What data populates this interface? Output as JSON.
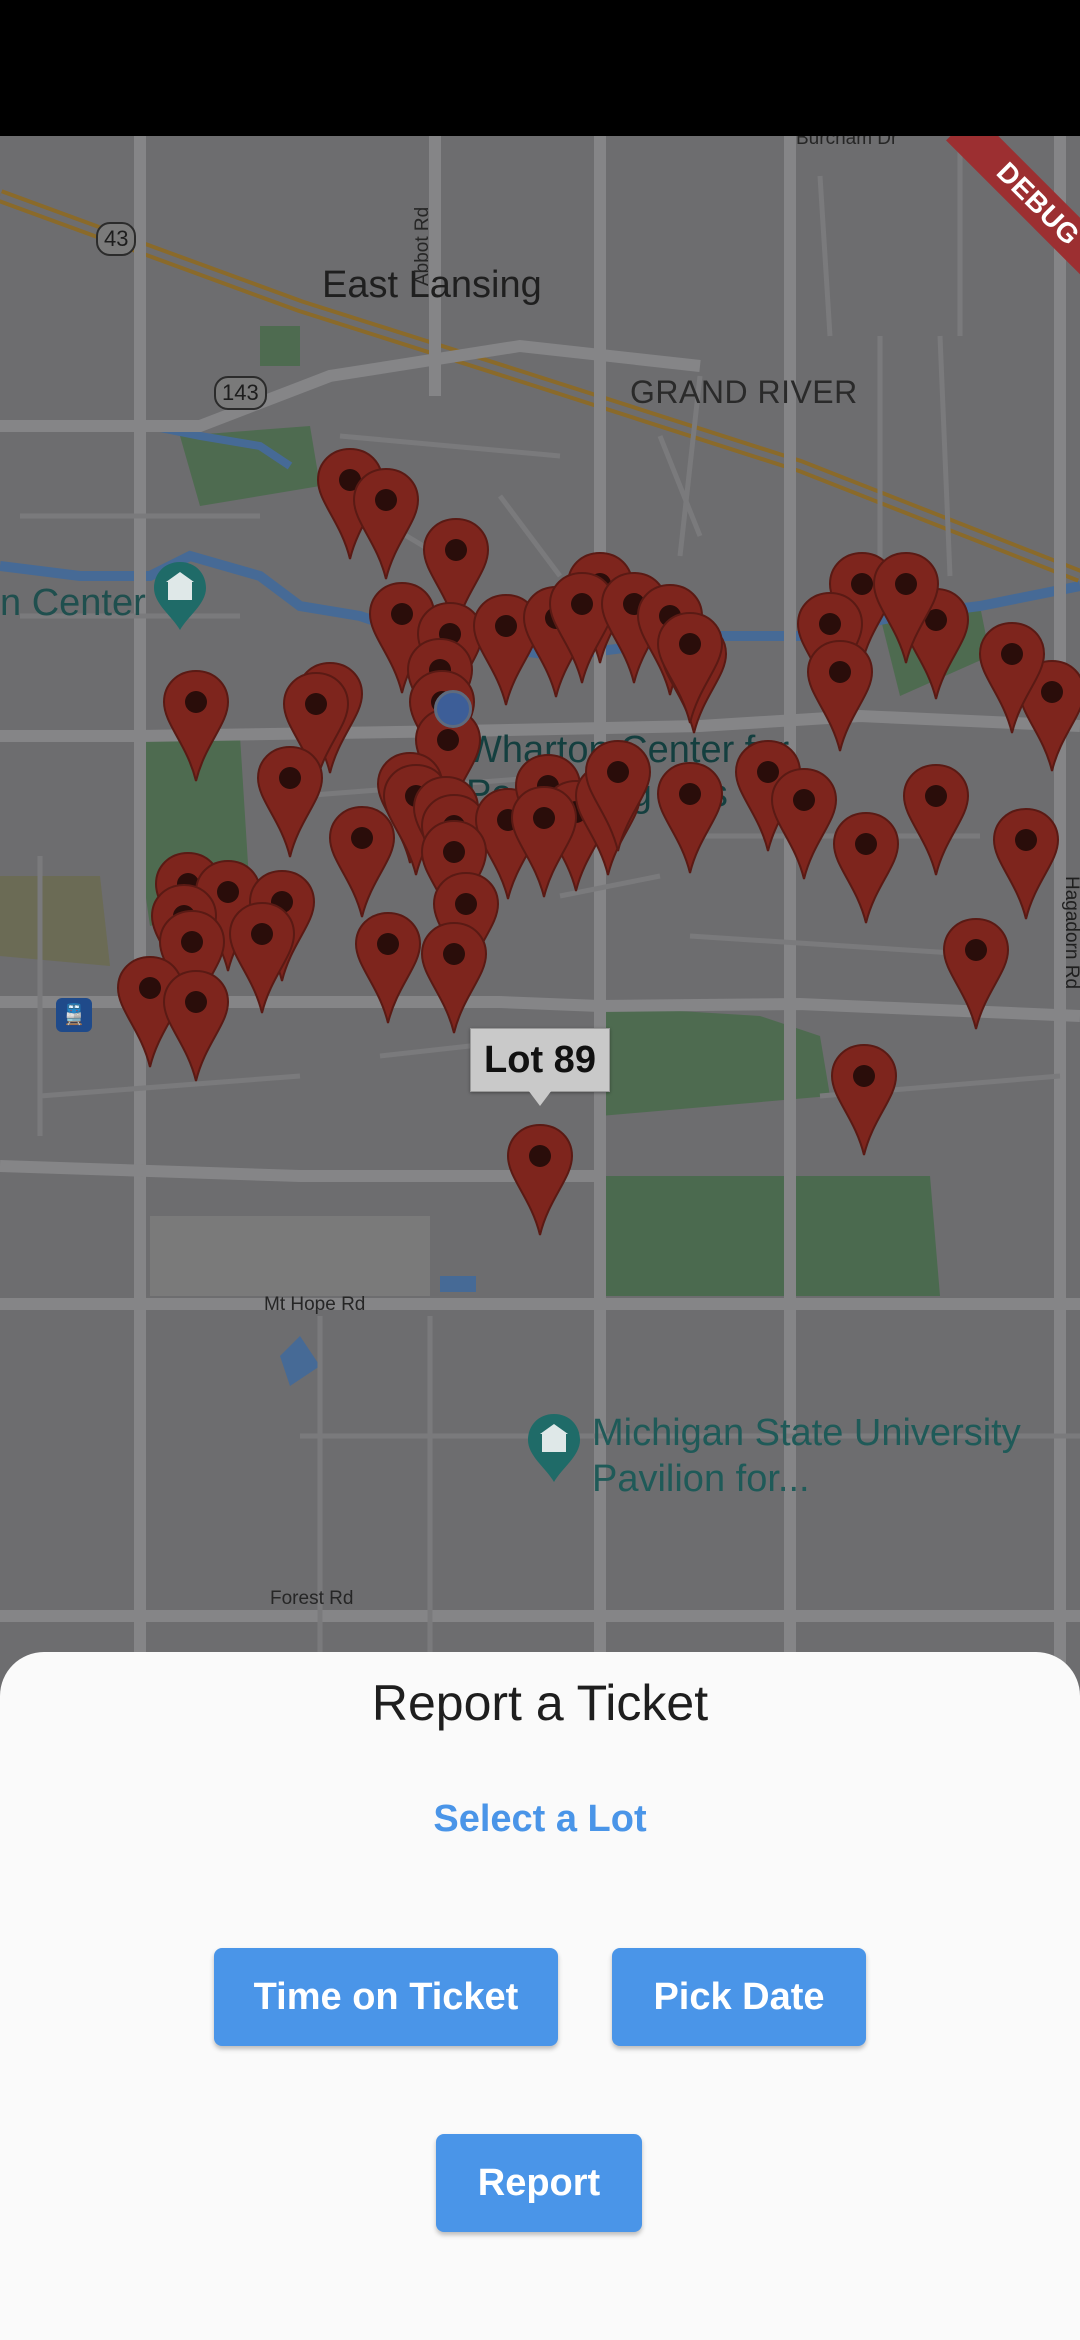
{
  "map": {
    "labels": {
      "city": "East Lansing",
      "district": "GRAND RIVER",
      "abbot_rd": "Abbot Rd",
      "burcham": "Burcham Dr",
      "hagadorn": "Hagadorn Rd",
      "mt_hope": "Mt Hope Rd",
      "forest": "Forest Rd",
      "n_center": "n Center",
      "wharton": "Wharton Center for Performing Arts",
      "pavilion_line1": "Michigan State University",
      "pavilion_line2": "Pavilion for...",
      "route_43": "43",
      "route_143": "143"
    },
    "selected_lot_label": "Lot 89",
    "pin_color": "#7e251d"
  },
  "debug": "DEBUG",
  "sheet": {
    "title": "Report a Ticket",
    "select_lot": "Select a Lot",
    "time_button": "Time on Ticket",
    "date_button": "Pick Date",
    "report_button": "Report"
  },
  "colors": {
    "accent": "#4a95e8",
    "map_overlay": "#6d6d6f"
  }
}
